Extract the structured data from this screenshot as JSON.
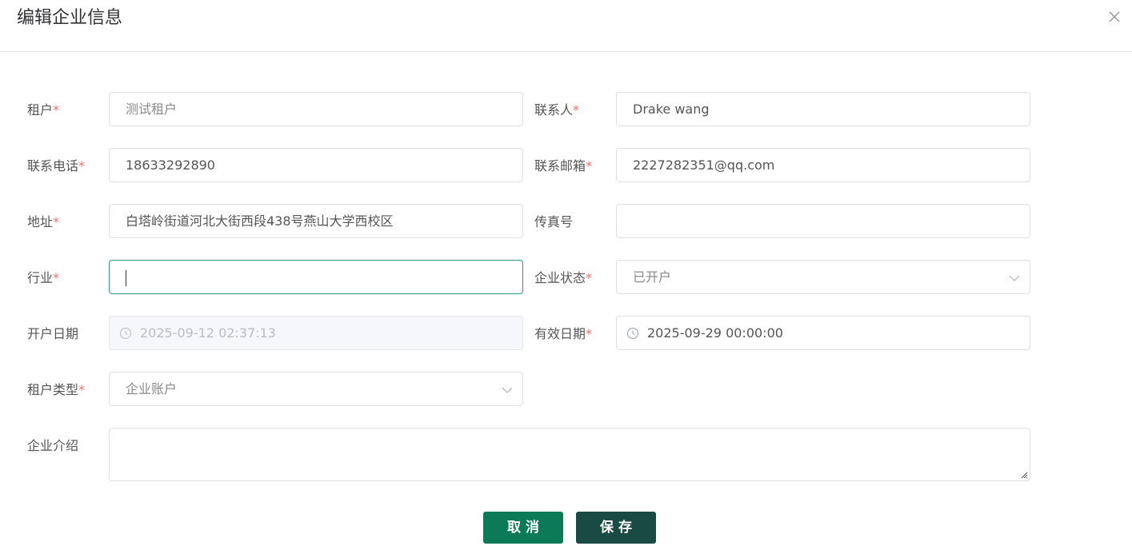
{
  "dialog": {
    "title": "编辑企业信息"
  },
  "required_mark": "*",
  "fields": {
    "tenant": {
      "label": "租户",
      "value": "测试租户"
    },
    "contact": {
      "label": "联系人",
      "value": "Drake wang"
    },
    "phone": {
      "label": "联系电话",
      "value": "18633292890"
    },
    "email": {
      "label": "联系邮箱",
      "value": "2227282351@qq.com"
    },
    "address": {
      "label": "地址",
      "value": "白塔岭街道河北大街西段438号燕山大学西校区"
    },
    "fax": {
      "label": "传真号",
      "value": ""
    },
    "industry": {
      "label": "行业",
      "value": ""
    },
    "status": {
      "label": "企业状态",
      "value": "已开户"
    },
    "open_date": {
      "label": "开户日期",
      "value": "2025-09-12 02:37:13"
    },
    "valid_date": {
      "label": "有效日期",
      "value": "2025-09-29 00:00:00"
    },
    "tenant_type": {
      "label": "租户类型",
      "value": "企业账户"
    },
    "intro": {
      "label": "企业介绍",
      "value": ""
    }
  },
  "buttons": {
    "cancel": "取消",
    "save": "保存"
  },
  "icons": {
    "close": "close-icon",
    "clock": "clock-icon",
    "chevron": "chevron-down-icon"
  },
  "colors": {
    "required": "#f56c6c",
    "cancel_button": "#0d7a57",
    "save_button": "#1a4a44",
    "focus_border": "#2e9a72"
  }
}
